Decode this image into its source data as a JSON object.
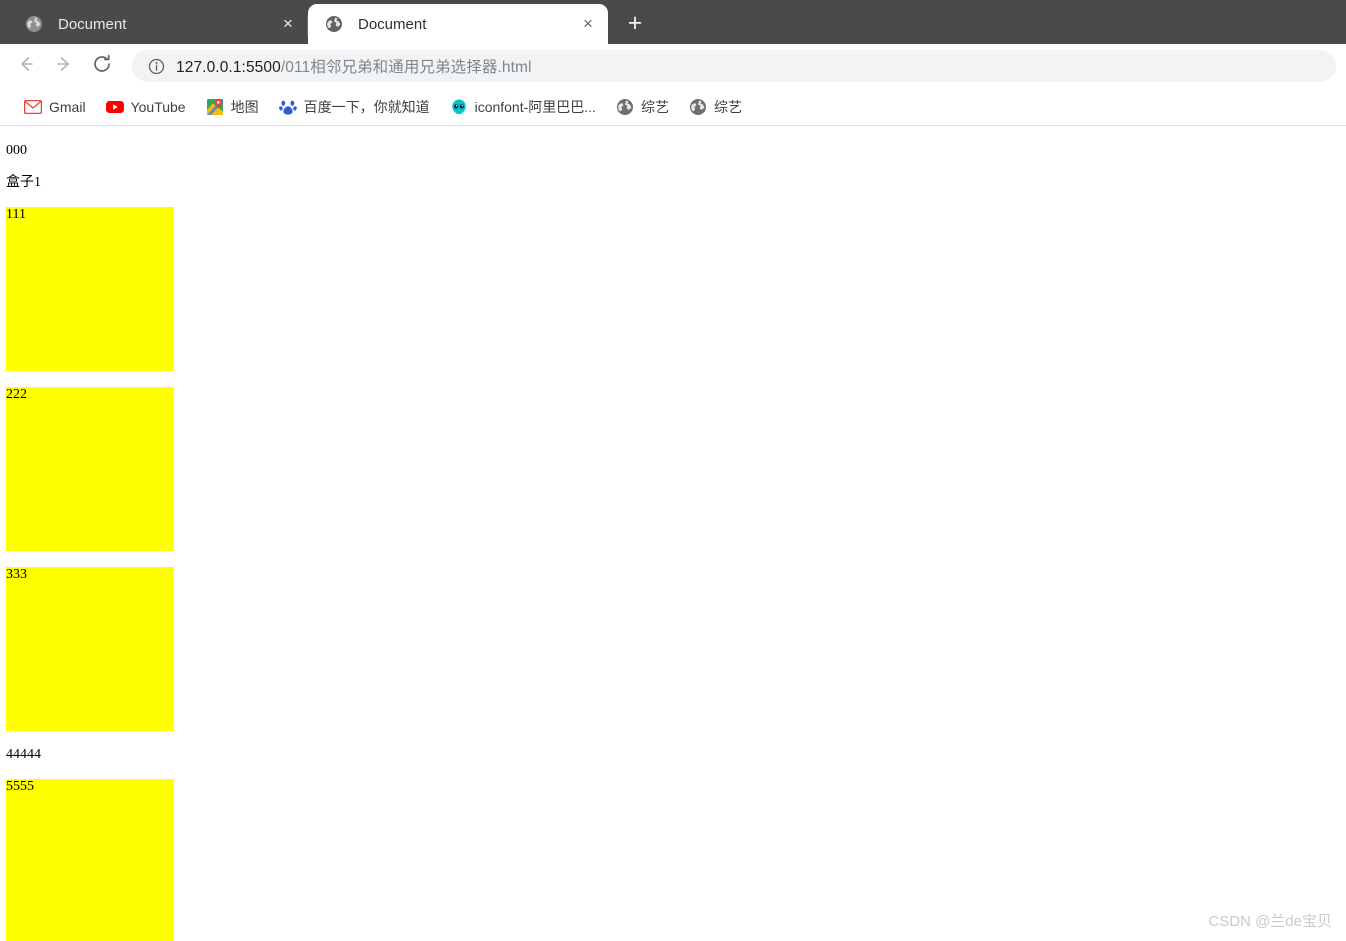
{
  "browser": {
    "tabs": [
      {
        "title": "Document",
        "favicon": "globe-icon",
        "close_label": "×",
        "active": false
      },
      {
        "title": "Document",
        "favicon": "globe-icon",
        "close_label": "×",
        "active": true
      }
    ],
    "new_tab_label": "+",
    "toolbar": {
      "back_icon": "back-arrow-icon",
      "forward_icon": "forward-arrow-icon",
      "reload_icon": "reload-icon",
      "site_info_icon": "info-circle-icon",
      "url_origin": "127.0.0.1:5500",
      "url_path": "/011相邻兄弟和通用兄弟选择器.html",
      "url_full": "127.0.0.1:5500/011相邻兄弟和通用兄弟选择器.html"
    },
    "bookmarks": [
      {
        "label": "Gmail",
        "icon": "gmail-icon"
      },
      {
        "label": "YouTube",
        "icon": "youtube-icon"
      },
      {
        "label": "地图",
        "icon": "google-maps-icon"
      },
      {
        "label": "百度一下，你就知道",
        "icon": "baidu-icon"
      },
      {
        "label": "iconfont-阿里巴巴...",
        "icon": "iconfont-icon"
      },
      {
        "label": "综艺",
        "icon": "globe-icon"
      },
      {
        "label": "综艺",
        "icon": "globe-icon"
      }
    ]
  },
  "page": {
    "blocks": [
      {
        "kind": "text",
        "text": "000"
      },
      {
        "kind": "text",
        "text": "盒子1"
      },
      {
        "kind": "box",
        "text": "111"
      },
      {
        "kind": "box",
        "text": "222"
      },
      {
        "kind": "box",
        "text": "333"
      },
      {
        "kind": "text",
        "text": "44444"
      },
      {
        "kind": "box",
        "text": "5555"
      }
    ],
    "box_color": "#ffff00"
  },
  "watermark": {
    "text": "CSDN @兰de宝贝"
  }
}
